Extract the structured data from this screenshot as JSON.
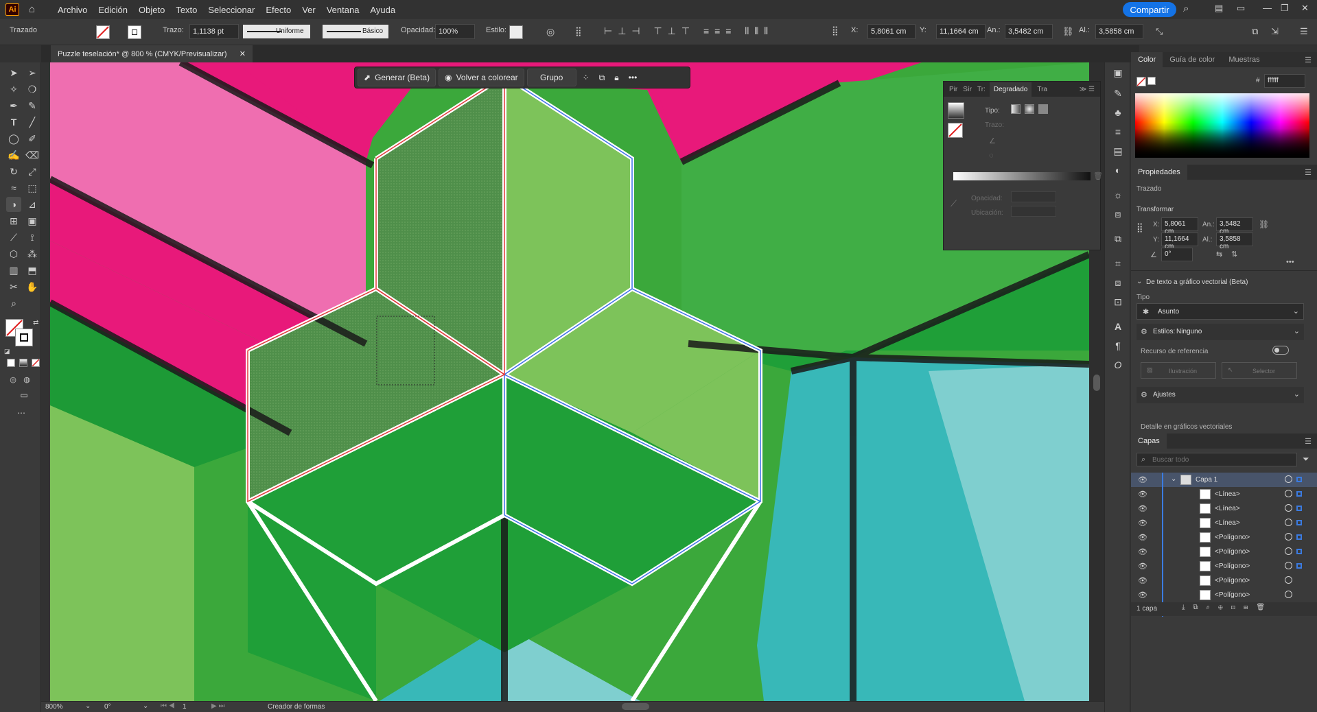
{
  "menubar": {
    "logo": "Ai",
    "items": [
      "Archivo",
      "Edición",
      "Objeto",
      "Texto",
      "Seleccionar",
      "Efecto",
      "Ver",
      "Ventana",
      "Ayuda"
    ],
    "share_label": "Compartir"
  },
  "control_bar": {
    "object_type": "Trazado",
    "stroke_label": "Trazo:",
    "stroke_value": "1,1138 pt",
    "profile_label": "Uniforme",
    "brush_label": "Básico",
    "opacity_label": "Opacidad:",
    "opacity_value": "100%",
    "style_label": "Estilo:",
    "x_label": "X:",
    "x_value": "5,8061 cm",
    "y_label": "Y:",
    "y_value": "11,1664 cm",
    "w_label": "An.:",
    "w_value": "3,5482 cm",
    "h_label": "Al.:",
    "h_value": "3,5858 cm"
  },
  "document": {
    "tab_title": "Puzzle teselación* @ 800 % (CMYK/Previsualizar)"
  },
  "context_toolbar": {
    "generate_label": "Generar (Beta)",
    "recolor_label": "Volver a colorear",
    "group_label": "Grupo"
  },
  "gradient_panel": {
    "tabs": [
      "Pir",
      "Sír",
      "Tr:",
      "Degradado",
      "Tra"
    ],
    "type_label": "Tipo:",
    "stroke_label": "Trazo:",
    "opacity_label": "Opacidad:",
    "location_label": "Ubicación:"
  },
  "color_panel": {
    "tabs": [
      "Color",
      "Guía de color",
      "Muestras"
    ],
    "hex_value": "ffffff"
  },
  "properties_panel": {
    "title": "Propiedades",
    "object_type": "Trazado",
    "transform_title": "Transformar",
    "x_label": "X:",
    "x_value": "5,8061 cm",
    "y_label": "Y:",
    "y_value": "11,1664 cm",
    "w_label": "An.:",
    "w_value": "3,5482 cm",
    "h_label": "Al.:",
    "h_value": "3,5858 cm",
    "angle_value": "0°",
    "vector_section": "De texto a gráfico vectorial (Beta)",
    "type_label": "Tipo",
    "type_value": "Asunto",
    "styles_label": "Estilos:",
    "styles_value": "Ninguno",
    "reference_label": "Recurso de referencia",
    "illustration_label": "Ilustración",
    "selector_label": "Selector",
    "adjustments_label": "Ajustes",
    "detail_label": "Detalle en gráficos vectoriales"
  },
  "layers_panel": {
    "title": "Capas",
    "search_placeholder": "Buscar todo",
    "parent_layer": "Capa 1",
    "rows": [
      "<Línea>",
      "<Línea>",
      "<Línea>",
      "<Polígono>",
      "<Polígono>",
      "<Polígono>",
      "<Polígono>",
      "<Polígono>",
      "<Polígono>"
    ],
    "footer": "1 capa"
  },
  "status_bar": {
    "zoom": "800%",
    "rotation": "0°",
    "artboard": "1",
    "tool_name": "Creador de formas"
  },
  "colors": {
    "magenta": "#e8197a",
    "pink": "#ef6eb0",
    "light_green": "#7dc35a",
    "mid_green": "#40ae45",
    "dark_green": "#1f9f38",
    "cyan": "#38b8b8",
    "light_cyan": "#7fcfcf",
    "share_blue": "#1473e6",
    "selection_blue": "#3b6fe8",
    "selection_red": "#e03a3a"
  }
}
